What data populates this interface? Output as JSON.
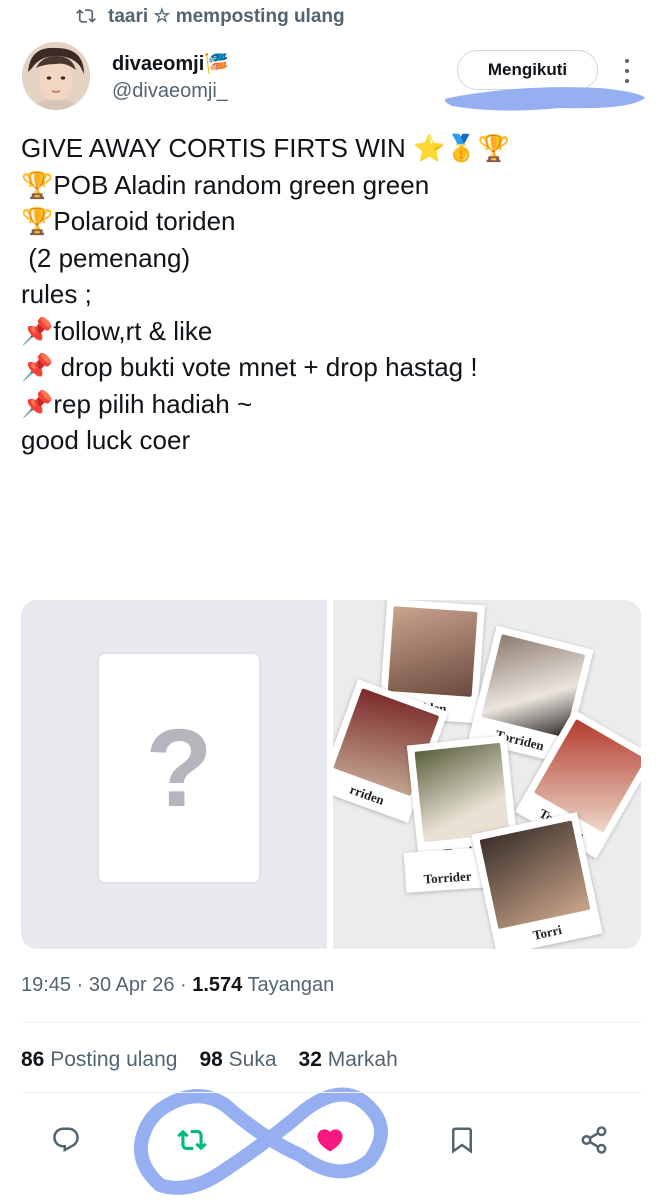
{
  "repost": {
    "text": "taari ☆ memposting ulang"
  },
  "author": {
    "name": "divaeomji",
    "name_emoji": "🎏",
    "handle": "@divaeomji_"
  },
  "follow_label": "Mengikuti",
  "tweet_lines": [
    "GIVE AWAY CORTIS FIRTS WIN ⭐🥇🏆",
    "",
    "🏆POB Aladin random green green",
    "🏆Polaroid toriden",
    " (2 pemenang)",
    "",
    "rules ;",
    "📌follow,rt & like",
    "📌 drop bukti vote mnet + drop hastag !",
    "📌rep pilih hadiah ~",
    "",
    "good luck coer"
  ],
  "media": {
    "placeholder_glyph": "?",
    "polaroid_labels": [
      "rriden",
      "Torriden",
      "rriden",
      "Torriden",
      "Torriden",
      "Torrider",
      "Torri"
    ]
  },
  "meta": {
    "time": "19:45",
    "date": "30 Apr 26",
    "views_count": "1.574",
    "views_label": "Tayangan"
  },
  "stats": {
    "reposts_count": "86",
    "reposts_label": "Posting ulang",
    "likes_count": "98",
    "likes_label": "Suka",
    "bookmarks_count": "32",
    "bookmarks_label": "Markah"
  },
  "colors": {
    "repost_green": "#00ba7c",
    "like_pink": "#f91880",
    "annotation_blue": "#8aa6f0"
  },
  "icons": [
    "repost-icon",
    "more-icon",
    "reply-icon",
    "retweet-icon",
    "like-icon",
    "bookmark-icon",
    "share-icon"
  ]
}
